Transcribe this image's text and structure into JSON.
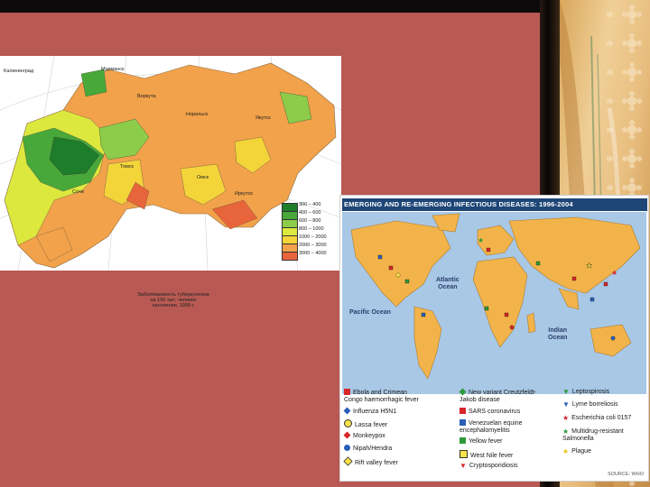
{
  "colors": {
    "background": "#b85a53",
    "title_bar": "#1e4677",
    "ocean": "#a8c8e6",
    "land": "#f2b44a"
  },
  "russia_map": {
    "cities": [
      "Калининград",
      "Мурманск",
      "Воркута",
      "Норильск",
      "Якутск",
      "Сочи",
      "Томск",
      "Омск",
      "Иркутск"
    ],
    "scale": [
      {
        "label": "300 – 400",
        "color": "#1e7d2a"
      },
      {
        "label": "400 – 600",
        "color": "#48a83a"
      },
      {
        "label": "600 – 800",
        "color": "#8ccc4a"
      },
      {
        "label": "800 – 1000",
        "color": "#dde83e"
      },
      {
        "label": "1000 – 2000",
        "color": "#f3d53a"
      },
      {
        "label": "2000 – 3000",
        "color": "#f2a24a"
      },
      {
        "label": "3000 – 4000",
        "color": "#e8643a"
      }
    ],
    "caption": "Заболеваемость туберкулезом\nна 100 тыс. человек\nнаселения, 1999 г."
  },
  "world_map": {
    "title": "EMERGING AND RE-EMERGING INFECTIOUS DISEASES: 1996-2004",
    "oceans": {
      "atlantic": "Atlantic\nOcean",
      "pacific": "Pacific Ocean",
      "indian": "Indian\nOcean"
    },
    "legend": [
      {
        "label": "Ebola and Crimean\nCongo haemorrhagic fever",
        "shape": "square",
        "color": "#d8262a"
      },
      {
        "label": "Influenza H5N1",
        "shape": "diamond",
        "color": "#2a5fb8"
      },
      {
        "label": "Lassa fever",
        "shape": "circle",
        "color": "#f7e24a"
      },
      {
        "label": "Monkeypox",
        "shape": "diamond",
        "color": "#d8262a"
      },
      {
        "label": "Nipah/Hendra",
        "shape": "circle",
        "color": "#2a5fb8"
      },
      {
        "label": "Rift valley fever",
        "shape": "diamond",
        "color": "#f7e24a"
      },
      {
        "label": "New variant Creutzfeldt-\nJakob disease",
        "shape": "diamond",
        "color": "#2e9a3a"
      },
      {
        "label": "SARS coronavirus",
        "shape": "square",
        "color": "#d8262a"
      },
      {
        "label": "Venezuelan equine\nencephalomyelitis",
        "shape": "square",
        "color": "#2a5fb8"
      },
      {
        "label": "Yellow fever",
        "shape": "square",
        "color": "#2e9a3a"
      },
      {
        "label": "West Nile fever",
        "shape": "square",
        "color": "#f7e24a"
      },
      {
        "label": "Cryptosporidiosis",
        "shape": "triangle",
        "color": "#d8262a"
      },
      {
        "label": "Leptospirosis",
        "shape": "triangle",
        "color": "#2e9a3a"
      },
      {
        "label": "Lyme borreliosis",
        "shape": "triangle",
        "color": "#2a5fb8"
      },
      {
        "label": "Escherichia coli  0157",
        "shape": "star",
        "color": "#d8262a"
      },
      {
        "label": "Multidrug-resistant\nSalmonella",
        "shape": "star",
        "color": "#2e9a3a"
      },
      {
        "label": "Plague",
        "shape": "star",
        "color": "#f7e24a"
      }
    ],
    "source": "SOURCE: WHO"
  }
}
